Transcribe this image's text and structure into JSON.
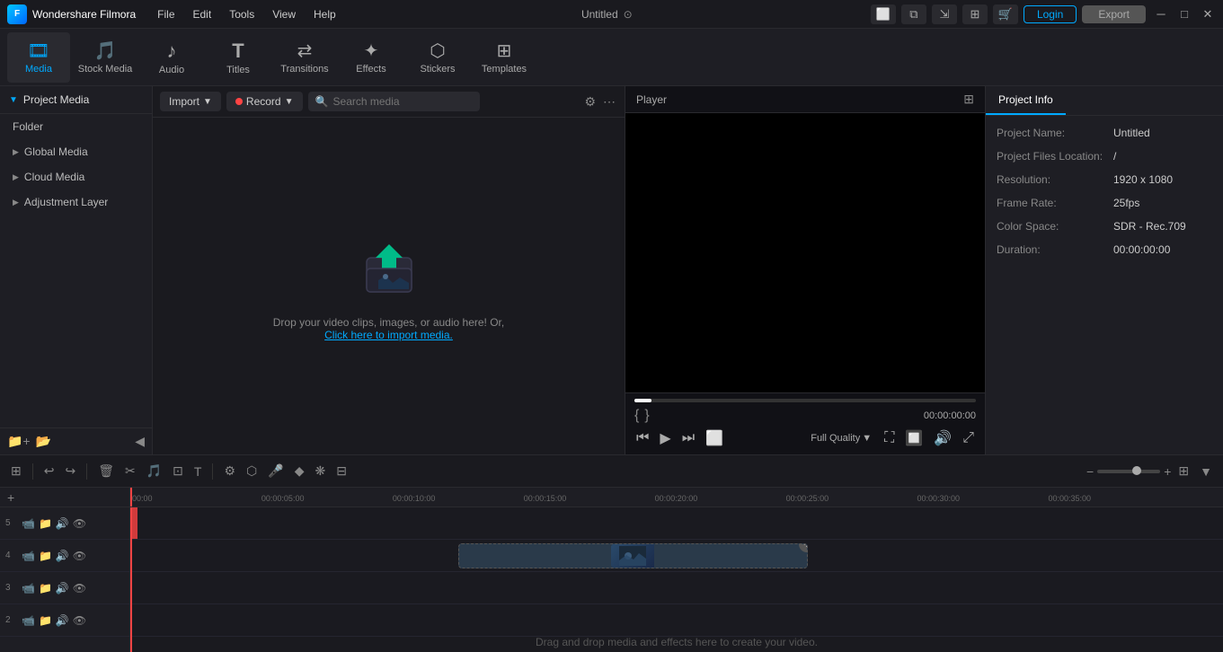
{
  "app": {
    "name": "Wondershare Filmora",
    "title": "Untitled"
  },
  "titlebar": {
    "menu_items": [
      "File",
      "Edit",
      "Tools",
      "View",
      "Help"
    ],
    "login_label": "Login",
    "export_label": "Export",
    "title": "Untitled"
  },
  "toolbar": {
    "items": [
      {
        "id": "media",
        "label": "Media",
        "icon": "🎞",
        "active": true
      },
      {
        "id": "stock",
        "label": "Stock Media",
        "icon": "🎵",
        "active": false
      },
      {
        "id": "audio",
        "label": "Audio",
        "icon": "♪",
        "active": false
      },
      {
        "id": "titles",
        "label": "Titles",
        "icon": "T",
        "active": false
      },
      {
        "id": "transitions",
        "label": "Transitions",
        "icon": "↔",
        "active": false
      },
      {
        "id": "effects",
        "label": "Effects",
        "icon": "✦",
        "active": false
      },
      {
        "id": "stickers",
        "label": "Stickers",
        "icon": "🙂",
        "active": false
      },
      {
        "id": "templates",
        "label": "Templates",
        "icon": "⊞",
        "active": false
      }
    ]
  },
  "left_panel": {
    "section_label": "Project Media",
    "items": [
      {
        "label": "Folder"
      },
      {
        "label": "Global Media"
      },
      {
        "label": "Cloud Media"
      },
      {
        "label": "Adjustment Layer"
      }
    ]
  },
  "media_panel": {
    "import_label": "Import",
    "record_label": "Record",
    "search_placeholder": "Search media",
    "drop_text": "Drop your video clips, images, or audio here! Or,",
    "drop_link": "Click here to import media."
  },
  "player": {
    "title": "Player",
    "quality_label": "Full Quality",
    "time_display": "00:00:00:00",
    "mark_in": "{",
    "mark_out": "}"
  },
  "right_panel": {
    "tabs": [
      "Project Info"
    ],
    "active_tab": "Project Info",
    "info": {
      "project_name_label": "Project Name:",
      "project_name_value": "Untitled",
      "files_location_label": "Project Files Location:",
      "files_location_value": "/",
      "resolution_label": "Resolution:",
      "resolution_value": "1920 x 1080",
      "frame_rate_label": "Frame Rate:",
      "frame_rate_value": "25fps",
      "color_space_label": "Color Space:",
      "color_space_value": "SDR - Rec.709",
      "duration_label": "Duration:",
      "duration_value": "00:00:00:00"
    }
  },
  "timeline": {
    "tracks": [
      {
        "num": "5",
        "icons": [
          "📹",
          "📁",
          "🔊",
          "👁"
        ]
      },
      {
        "num": "4",
        "icons": [
          "📹",
          "📁",
          "🔊",
          "👁"
        ]
      },
      {
        "num": "3",
        "icons": [
          "📹",
          "📁",
          "🔊",
          "👁"
        ]
      },
      {
        "num": "2",
        "icons": [
          "📹",
          "📁",
          "🔊",
          "👁"
        ]
      }
    ],
    "ruler_labels": [
      "00:00",
      "00:00:05:00",
      "00:00:10:00",
      "00:00:15:00",
      "00:00:20:00",
      "00:00:25:00",
      "00:00:30:00",
      "00:00:35:00"
    ],
    "empty_text": "Drag and drop media and effects here to create your video."
  },
  "colors": {
    "accent": "#00aaff",
    "record_red": "#ff4444",
    "bg_dark": "#1a1a1f",
    "bg_panel": "#1e1e24",
    "text_primary": "#ccc",
    "text_secondary": "#888"
  }
}
